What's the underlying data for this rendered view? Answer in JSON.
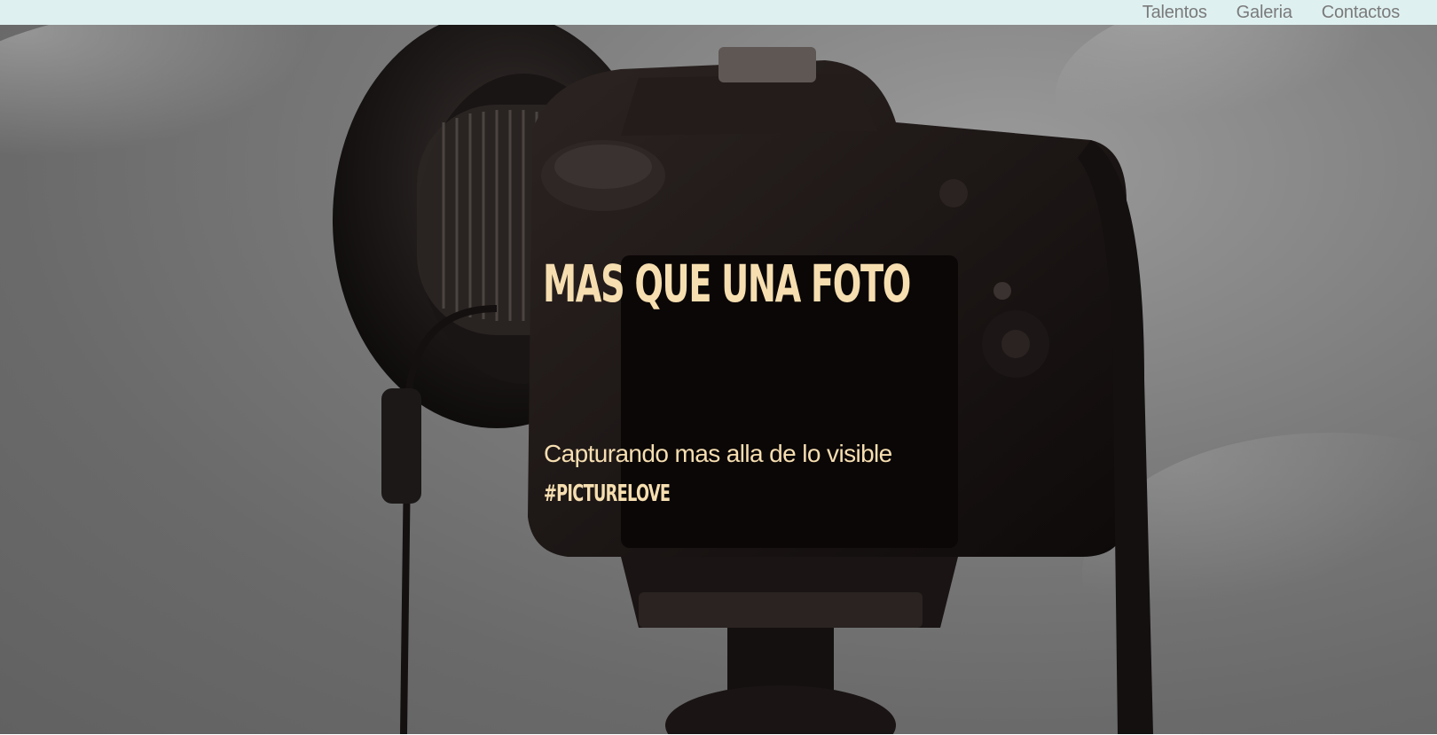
{
  "nav": {
    "items": [
      {
        "label": "Talentos"
      },
      {
        "label": "Galeria"
      },
      {
        "label": "Contactos"
      }
    ]
  },
  "hero": {
    "headline": "MAS QUE UNA FOTO",
    "subtitle": "Capturando mas alla de lo visible",
    "hashtag": "#PICTURELOVE",
    "image": "dslr-camera-on-tripod-photo"
  },
  "colors": {
    "topbar_bg": "#dff0f0",
    "nav_text": "#7a7a7a",
    "hero_text": "#f6deb0"
  }
}
